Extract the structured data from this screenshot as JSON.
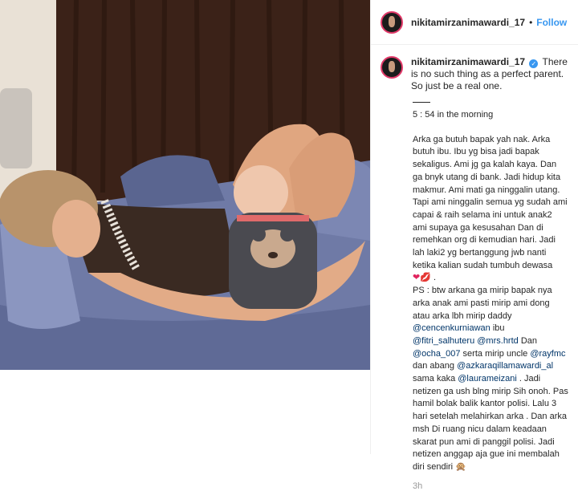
{
  "post": {
    "username": "nikitamirzanimawardi_17",
    "follow_label": "Follow",
    "separator": "•"
  },
  "caption": {
    "username": "nikitamirzanimawardi_17",
    "headline": "There is no such thing as a perfect parent. So just be a real one.",
    "time_line": "5 : 54 in the morning",
    "paragraph1": "Arka ga butuh bapak yah nak. Arka butuh ibu. Ibu yg bisa jadi bapak sekaligus. Ami jg ga kalah kaya. Dan ga bnyk utang di bank. Jadi hidup kita makmur. Ami mati ga ninggalin utang. Tapi ami ninggalin semua yg sudah ami capai & raih selama ini untuk anak2 ami supaya ga kesusahan Dan di remehkan org di kemudian hari. Jadi lah laki2 yg bertanggung jwb nanti ketika kalian sudah tumbuh dewasa",
    "emoji1": "❤",
    "emoji2": "💋",
    "ps_a": "PS : btw arkana ga mirip bapak nya arka anak ami pasti mirip ami dong atau arka lbh mirip daddy",
    "m1": "@cencenkurniawan",
    "t1": " ibu ",
    "m2": "@fitri_salhuteru",
    "m3": "@mrs.hrtd",
    "t2": " Dan ",
    "m4": "@ocha_007",
    "t3": " serta mirip uncle ",
    "m5": "@rayfmc",
    "t4": " dan abang ",
    "m6": "@azkaraqillamawardi_al",
    "t5": " sama kaka ",
    "m7": "@laurameizani",
    "ps_b": " . Jadi netizen ga ush blng mirip Sih onoh. Pas hamil bolak balik kantor polisi. Lalu 3 hari setelah melahirkan arka . Dan arka msh Di ruang nicu dalam keadaan skarat pun ami di panggil polisi. Jadi netizen anggap aja gue ini membalah diri sendiri",
    "emoji3": "🙊",
    "time_ago": "3h"
  },
  "colors": {
    "accent": "#3897f0",
    "text": "#262626",
    "muted": "#999999",
    "mention": "#003569"
  }
}
